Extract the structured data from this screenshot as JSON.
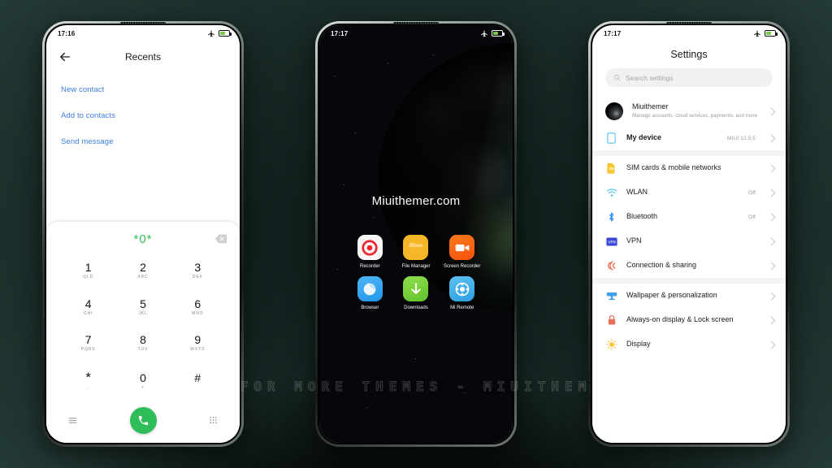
{
  "watermark": "VISIT FOR MORE THEMES - MIUITHEMER.COM",
  "colors": {
    "accent_green": "#2fbd5a",
    "link_blue": "#3b7ddd",
    "background_teal": "#2b413d",
    "battery_green": "#7ac943"
  },
  "phone_recents": {
    "status_bar": {
      "time": "17:16",
      "airplane_icon": "airplane-icon",
      "battery_icon": "battery-icon"
    },
    "header": {
      "back_icon": "back-arrow-icon",
      "title": "Recents"
    },
    "actions": [
      {
        "label": "New contact",
        "name": "new-contact"
      },
      {
        "label": "Add to contacts",
        "name": "add-to-contacts"
      },
      {
        "label": "Send message",
        "name": "send-message"
      }
    ],
    "dialpad": {
      "dialed_number": "*0*",
      "backspace_icon": "backspace-icon",
      "keys": [
        {
          "digit": "1",
          "letters": "QLD"
        },
        {
          "digit": "2",
          "letters": "ABC"
        },
        {
          "digit": "3",
          "letters": "DEF"
        },
        {
          "digit": "4",
          "letters": "GHI"
        },
        {
          "digit": "5",
          "letters": "JKL"
        },
        {
          "digit": "6",
          "letters": "MNO"
        },
        {
          "digit": "7",
          "letters": "PQRS"
        },
        {
          "digit": "8",
          "letters": "TUV"
        },
        {
          "digit": "9",
          "letters": "WXYZ"
        },
        {
          "digit": "*",
          "letters": ","
        },
        {
          "digit": "0",
          "letters": "+"
        },
        {
          "digit": "#",
          "letters": ""
        }
      ],
      "bottom_bar": {
        "menu_icon": "hamburger-menu-icon",
        "call_icon": "phone-call-icon",
        "keypad_icon": "keypad-icon"
      }
    }
  },
  "phone_home": {
    "status_bar": {
      "time": "17:17",
      "airplane_icon": "airplane-icon",
      "battery_icon": "battery-icon"
    },
    "title": "Miuithemer.com",
    "apps": [
      {
        "label": "Recorder",
        "icon": "recorder-icon"
      },
      {
        "label": "File Manager",
        "icon": "file-manager-icon"
      },
      {
        "label": "Screen Recorder",
        "icon": "screen-recorder-icon"
      },
      {
        "label": "Browser",
        "icon": "browser-icon"
      },
      {
        "label": "Downloads",
        "icon": "downloads-icon"
      },
      {
        "label": "Mi Remote",
        "icon": "mi-remote-icon"
      }
    ]
  },
  "phone_settings": {
    "status_bar": {
      "time": "17:17",
      "airplane_icon": "airplane-icon",
      "battery_icon": "battery-icon"
    },
    "title": "Settings",
    "search": {
      "placeholder": "Search settings",
      "icon": "search-icon"
    },
    "account": {
      "name": "Miuithemer",
      "subtitle": "Manage accounts, cloud services, payments, and more",
      "avatar": "account-avatar"
    },
    "rows_group1": [
      {
        "label": "My device",
        "value": "MIUI 12.5.5",
        "icon": "device-icon",
        "bold": true
      }
    ],
    "rows_group2": [
      {
        "label": "SIM cards & mobile networks",
        "value": "",
        "icon": "sim-card-icon"
      },
      {
        "label": "WLAN",
        "value": "Off",
        "icon": "wifi-icon"
      },
      {
        "label": "Bluetooth",
        "value": "Off",
        "icon": "bluetooth-icon"
      },
      {
        "label": "VPN",
        "value": "",
        "icon": "vpn-icon"
      },
      {
        "label": "Connection & sharing",
        "value": "",
        "icon": "connection-sharing-icon"
      }
    ],
    "rows_group3": [
      {
        "label": "Wallpaper & personalization",
        "value": "",
        "icon": "wallpaper-icon"
      },
      {
        "label": "Always-on display & Lock screen",
        "value": "",
        "icon": "lock-icon"
      },
      {
        "label": "Display",
        "value": "",
        "icon": "display-brightness-icon"
      }
    ]
  }
}
